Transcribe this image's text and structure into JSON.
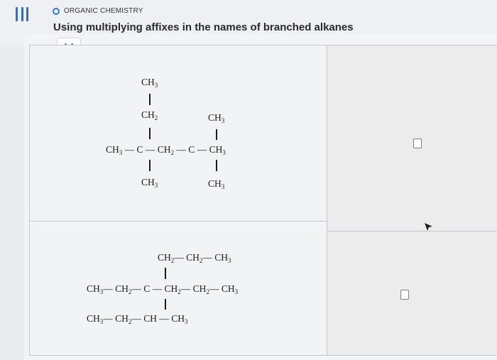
{
  "header": {
    "topic": "ORGANIC CHEMISTRY",
    "title": "Using multiplying affixes in the names of branched alkanes"
  },
  "icons": {
    "menu": "menu-icon",
    "topic_marker": "circle-icon",
    "dropdown": "chevron-down-icon",
    "cursor": "mouse-cursor-icon"
  },
  "colors": {
    "accent": "#2e7bd6",
    "chevron": "#3a6ea5",
    "text": "#222222"
  },
  "structure1": {
    "top_ch3": "CH",
    "top_ch3_sub": "3",
    "ch2": "CH",
    "ch2_sub": "2",
    "right_top_ch3": "CH",
    "right_top_ch3_sub": "3",
    "chain_ch3_left": "CH",
    "chain_ch3_left_sub": "3",
    "dash1": "—",
    "c1": "C",
    "dash2": "—",
    "chain_ch2": "CH",
    "chain_ch2_sub": "2",
    "dash3": "—",
    "c2": "C",
    "dash4": "—",
    "chain_ch3_right": "CH",
    "chain_ch3_right_sub": "3",
    "bottom_left_ch3": "CH",
    "bottom_left_ch3_sub": "3",
    "bottom_right_ch3": "CH",
    "bottom_right_ch3_sub": "3"
  },
  "structure2": {
    "top_row": [
      "CH",
      "2",
      "— CH",
      "2",
      "— CH",
      "3"
    ],
    "middle_row": [
      "CH",
      "3",
      "— CH",
      "2",
      "— C — CH",
      "2",
      "— CH",
      "2",
      "— CH",
      "3"
    ],
    "bottom_row": [
      "CH",
      "3",
      "— CH",
      "2",
      "— CH — CH",
      "3"
    ]
  },
  "answers": {
    "row1_value": "",
    "row2_value": ""
  }
}
